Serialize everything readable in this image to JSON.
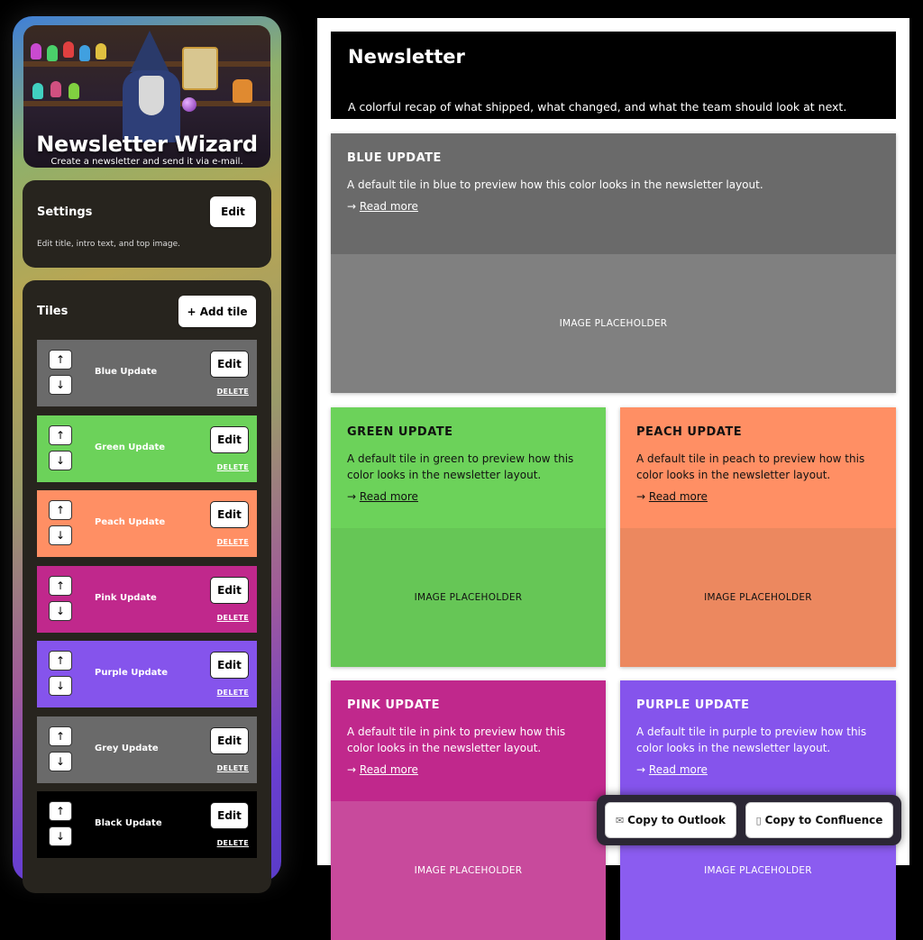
{
  "app": {
    "title": "Newsletter Wizard",
    "subtitle": "Create a newsletter and send it via e-mail."
  },
  "settings": {
    "title": "Settings",
    "edit_label": "Edit",
    "note": "Edit title, intro text, and top image."
  },
  "tiles_panel": {
    "title": "Tiles",
    "add_label": "+ Add tile",
    "up_glyph": "↑",
    "down_glyph": "↓",
    "edit_label": "Edit",
    "delete_label": "DELETE",
    "items": [
      {
        "name": "Blue Update",
        "color": "#6a6a6a"
      },
      {
        "name": "Green Update",
        "color": "#6cd25a"
      },
      {
        "name": "Peach Update",
        "color": "#ff8f64"
      },
      {
        "name": "Pink Update",
        "color": "#c0288c"
      },
      {
        "name": "Purple Update",
        "color": "#8554ec"
      },
      {
        "name": "Grey Update",
        "color": "#6a6a6a"
      },
      {
        "name": "Black Update",
        "color": "#000000"
      }
    ]
  },
  "newsletter": {
    "title": "Newsletter",
    "intro": "A colorful recap of what shipped, what changed, and what the team should look at next.",
    "read_more_arrow": "→",
    "read_more": "Read more",
    "image_placeholder": "IMAGE PLACEHOLDER",
    "cards": [
      {
        "title": "BLUE UPDATE",
        "desc": "A default tile in blue to preview how this color looks in the newsletter layout.",
        "color": "#6a6a6a",
        "img_color": "#808080",
        "text_color": "#ffffff"
      },
      {
        "title": "GREEN UPDATE",
        "desc": "A default tile in green to preview how this color looks in the newsletter layout.",
        "color": "#6cd25a",
        "img_color": "#66c656",
        "text_color": "#111111"
      },
      {
        "title": "PEACH UPDATE",
        "desc": "A default tile in peach to preview how this color looks in the newsletter layout.",
        "color": "#ff8f64",
        "img_color": "#ec885f",
        "text_color": "#111111"
      },
      {
        "title": "PINK UPDATE",
        "desc": "A default tile in pink to preview how this color looks in the newsletter layout.",
        "color": "#c0288c",
        "img_color": "#c84a9c",
        "text_color": "#ffffff"
      },
      {
        "title": "PURPLE UPDATE",
        "desc": "A default tile in purple to preview how this color looks in the newsletter layout.",
        "color": "#8554ec",
        "img_color": "#8b5cf0",
        "text_color": "#ffffff"
      }
    ]
  },
  "actions": {
    "copy_outlook": "Copy to Outlook",
    "copy_outlook_icon": "envelope-icon",
    "copy_confluence": "Copy to Confluence",
    "copy_confluence_icon": "document-icon"
  }
}
